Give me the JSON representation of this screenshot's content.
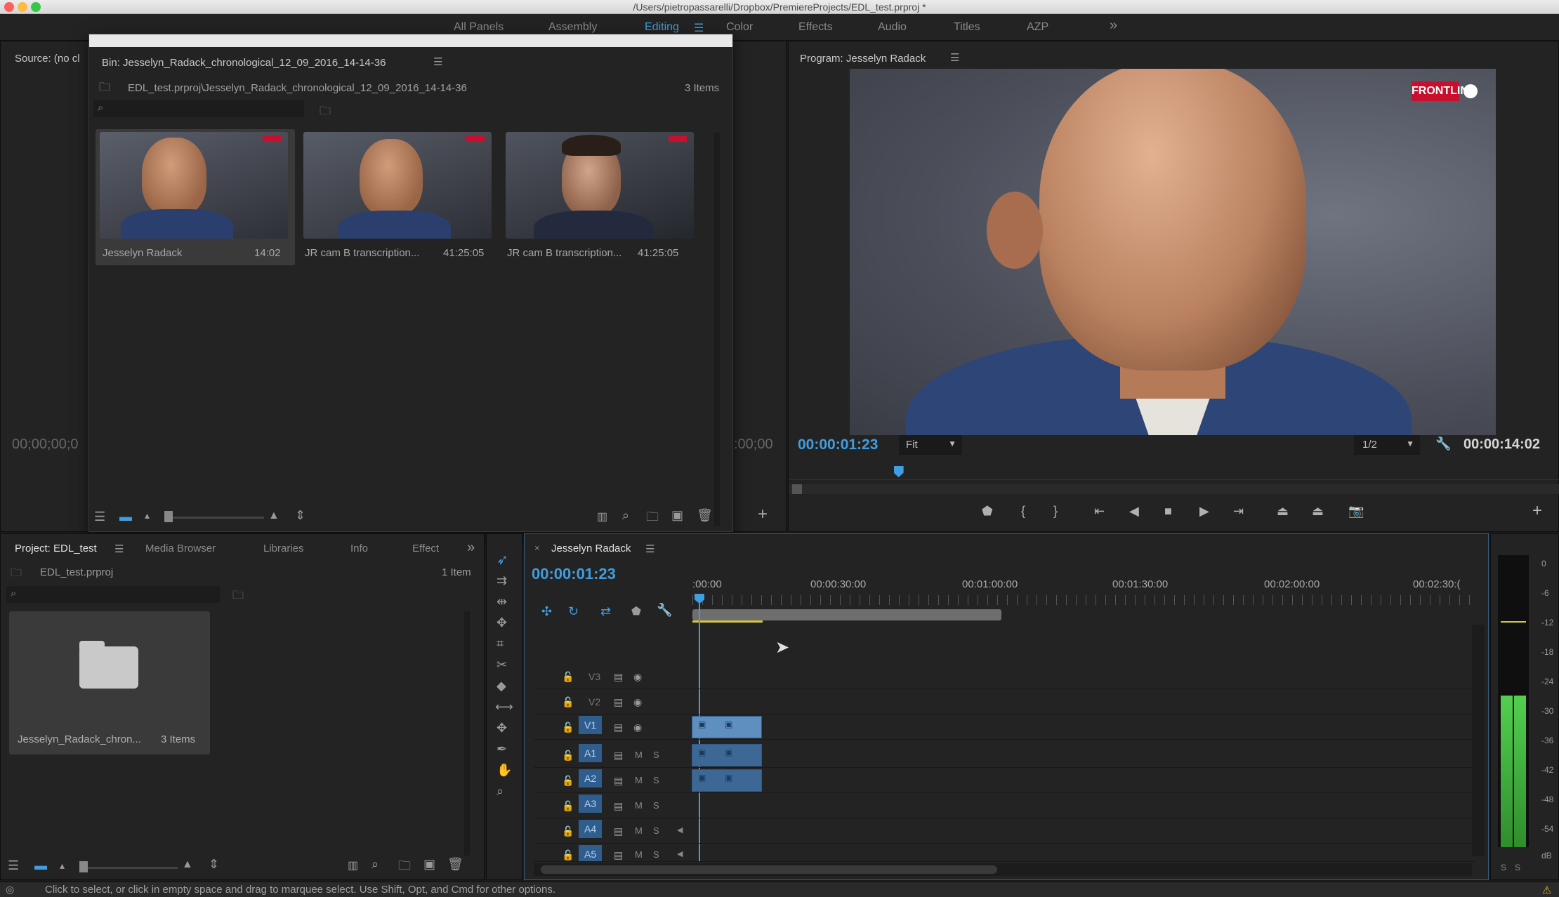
{
  "window": {
    "title": "/Users/pietropassarelli/Dropbox/PremiereProjects/EDL_test.prproj *",
    "traffic_colors": [
      "#fc605b",
      "#fdbc40",
      "#34c84a"
    ]
  },
  "workspaces": {
    "items": [
      "All Panels",
      "Assembly",
      "Editing",
      "Color",
      "Effects",
      "Audio",
      "Titles",
      "AZP"
    ],
    "active": "Editing",
    "overflow": "»"
  },
  "source": {
    "title": "Source: (no cl",
    "timecode": "00;00;00;0",
    "timecode_right": ":00;00"
  },
  "bin": {
    "title": "Bin: Jesselyn_Radack_chronological_12_09_2016_14-14-36",
    "path": "EDL_test.prproj\\Jesselyn_Radack_chronological_12_09_2016_14-14-36",
    "count": "3 Items",
    "items": [
      {
        "name": "Jesselyn Radack",
        "duration": "14:02"
      },
      {
        "name": "JR cam B transcription...",
        "duration": "41:25:05"
      },
      {
        "name": "JR cam B transcription...",
        "duration": "41:25:05"
      }
    ]
  },
  "program": {
    "title": "Program: Jesselyn Radack",
    "logo_text": "FRONTLINE",
    "timecode": "00:00:01:23",
    "fit": "Fit",
    "resolution": "1/2",
    "duration": "00:00:14:02",
    "playhead_fraction": 0.142
  },
  "project": {
    "tabs": [
      "Project: EDL_test",
      "Media Browser",
      "Libraries",
      "Info",
      "Effect"
    ],
    "path": "EDL_test.prproj",
    "count": "1 Item",
    "folder": {
      "name": "Jesselyn_Radack_chron...",
      "count": "3 Items"
    }
  },
  "timeline": {
    "tab": "Jesselyn Radack",
    "timecode": "00:00:01:23",
    "ruler": [
      ":00:00",
      "00:00:30:00",
      "00:01:00:00",
      "00:01:30:00",
      "00:02:00:00",
      "00:02:30:("
    ],
    "tracks": [
      {
        "name": "V3",
        "targeted": false
      },
      {
        "name": "V2",
        "targeted": false
      },
      {
        "name": "V1",
        "targeted": true
      },
      {
        "name": "A1",
        "targeted": true
      },
      {
        "name": "A2",
        "targeted": true
      },
      {
        "name": "A3",
        "targeted": true
      },
      {
        "name": "A4",
        "targeted": true
      },
      {
        "name": "A5",
        "targeted": true
      }
    ],
    "ms_labels": {
      "m": "M",
      "s": "S"
    }
  },
  "vu": {
    "scale": [
      "0",
      "-6",
      "-12",
      "-18",
      "-24",
      "-30",
      "-36",
      "-42",
      "-48",
      "-54",
      "dB"
    ],
    "solo": [
      "S",
      "S"
    ]
  },
  "status": {
    "text": "Click to select, or click in empty space and drag to marquee select. Use Shift, Opt, and Cmd for other options."
  },
  "colors": {
    "accent": "#3f9ee0",
    "panel": "#232323",
    "target": "#2e5d8e",
    "clip": "#5f8fbf",
    "logo": "#c8102e"
  }
}
